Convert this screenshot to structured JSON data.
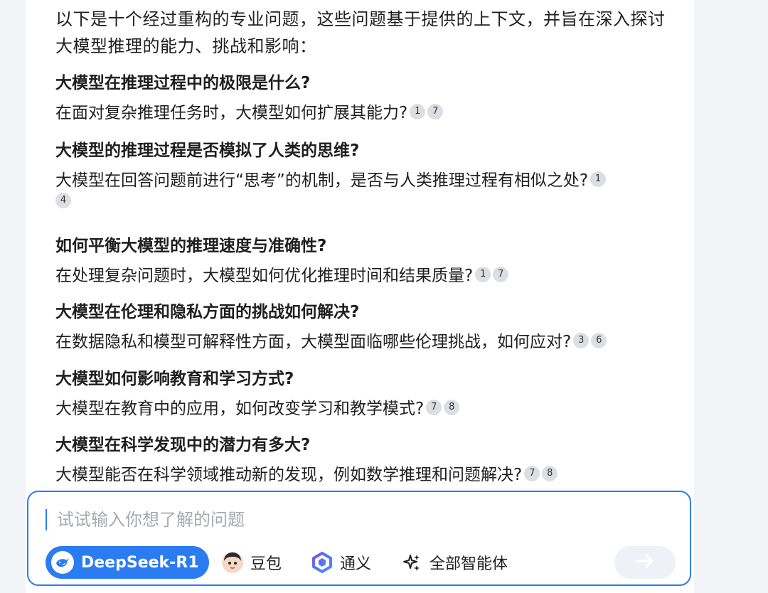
{
  "intro": "以下是十个经过重构的专业问题，这些问题基于提供的上下文，并旨在深入探讨大模型推理的能力、挑战和影响：",
  "questions": [
    {
      "title": "大模型在推理过程中的极限是什么?",
      "body": "在面对复杂推理任务时，大模型如何扩展其能力?",
      "cites": [
        "1",
        "7"
      ]
    },
    {
      "title": "大模型的推理过程是否模拟了人类的思维?",
      "body": "大模型在回答问题前进行“思考”的机制，是否与人类推理过程有相似之处?",
      "cites": [
        "1",
        "4"
      ]
    },
    {
      "title": "如何平衡大模型的推理速度与准确性?",
      "body": "在处理复杂问题时，大模型如何优化推理时间和结果质量?",
      "cites": [
        "1",
        "7"
      ]
    },
    {
      "title": "大模型在伦理和隐私方面的挑战如何解决?",
      "body": "在数据隐私和模型可解释性方面，大模型面临哪些伦理挑战，如何应对?",
      "cites": [
        "3",
        "6"
      ]
    },
    {
      "title": "大模型如何影响教育和学习方式?",
      "body": "大模型在教育中的应用，如何改变学习和教学模式?",
      "cites": [
        "7",
        "8"
      ]
    },
    {
      "title": "大模型在科学发现中的潜力有多大?",
      "body": "大模型能否在科学领域推动新的发现，例如数学推理和问题解决?",
      "cites": [
        "7",
        "8"
      ]
    }
  ],
  "input": {
    "placeholder": "试试输入你想了解的问题"
  },
  "toolbar": {
    "deepseek_label": "DeepSeek-R1",
    "doubao_label": "豆包",
    "tongyi_label": "通义",
    "all_agents_label": "全部智能体"
  },
  "colors": {
    "accent": "#2b7cf0",
    "citation_bg": "#dcdee3",
    "background": "#f3f4f7"
  },
  "icons": {
    "deepseek": "whale-icon",
    "doubao": "avatar-icon",
    "tongyi": "tongyi-logo-icon",
    "all": "sparkle-icon",
    "send": "arrow-right-icon"
  }
}
